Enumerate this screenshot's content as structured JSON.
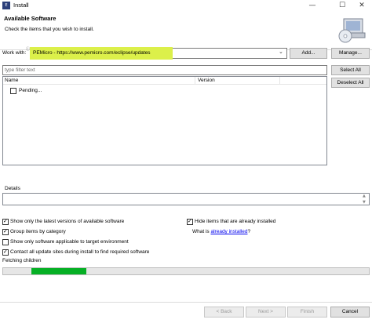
{
  "window": {
    "app_icon": "eclipse-install-icon",
    "title": "Install",
    "controls": {
      "minimize": "—",
      "maximize": "☐",
      "close": "✕"
    }
  },
  "banner": {
    "title": "Available Software",
    "subtitle": "Check the items that you wish to install.",
    "icon": "install-cd-icon"
  },
  "work_with": {
    "label": "Work with:",
    "value": "PEMicro - https://www.pemicro.com/eclipse/updates",
    "highlight_color": "#dcf04a",
    "add_label": "Add...",
    "manage_label": "Manage..."
  },
  "filter": {
    "placeholder": "type filter text",
    "select_all_label": "Select All",
    "deselect_all_label": "Deselect All"
  },
  "tree": {
    "columns": [
      "Name",
      "Version"
    ],
    "items": [
      {
        "label": "Pending...",
        "checked": false
      }
    ]
  },
  "details": {
    "label": "Details"
  },
  "options": {
    "latest_versions": {
      "label": "Show only the latest versions of available software",
      "checked": true
    },
    "group_by_category": {
      "label": "Group items by category",
      "checked": true
    },
    "target_env": {
      "label": "Show only software applicable to target environment",
      "checked": false
    },
    "contact_sites": {
      "label": "Contact all update sites during install to find required software",
      "checked": true
    },
    "hide_installed": {
      "label": "Hide items that are already installed",
      "checked": true
    },
    "what_is_prefix": "What is",
    "what_is_link": "already installed",
    "what_is_suffix": "?"
  },
  "status": {
    "text": "Fetching children",
    "progress_color": "#06b025"
  },
  "footer": {
    "back_label": "< Back",
    "next_label": "Next >",
    "finish_label": "Finish",
    "cancel_label": "Cancel"
  }
}
